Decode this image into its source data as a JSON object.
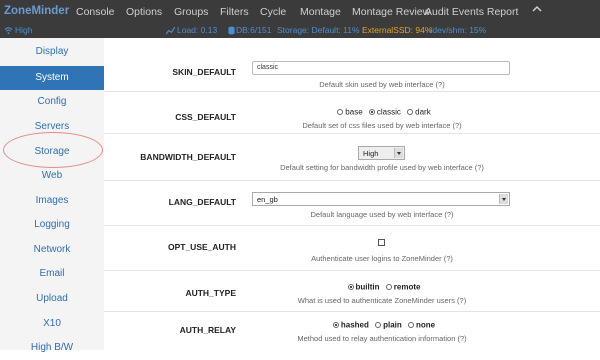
{
  "app": {
    "brand": "ZoneMinder",
    "nav": [
      "Console",
      "Options",
      "Groups",
      "Filters",
      "Cycle",
      "Montage",
      "Montage Review",
      "Audit Events Report"
    ]
  },
  "status": {
    "bandwidth": "High",
    "load": "Load: 0.13",
    "db": "DB:6/151",
    "storage": "Storage: Default: 11%",
    "external": "ExternalSSD: 94%",
    "shm": "/dev/shm: 15%"
  },
  "sidebar": {
    "items": [
      "Display",
      "System",
      "Config",
      "Servers",
      "Storage",
      "Web",
      "Images",
      "Logging",
      "Network",
      "Email",
      "Upload",
      "X10",
      "High B/W"
    ],
    "active": "System"
  },
  "options": {
    "skin_default": {
      "name": "SKIN_DEFAULT",
      "value": "classic",
      "help": "Default skin used by web interface (?)"
    },
    "css_default": {
      "name": "CSS_DEFAULT",
      "choices": [
        "base",
        "classic",
        "dark"
      ],
      "selected": "classic",
      "help": "Default set of css files used by web interface (?)"
    },
    "bandwidth_default": {
      "name": "BANDWIDTH_DEFAULT",
      "value": "High",
      "help": "Default setting for bandwidth profile used by web interface (?)"
    },
    "lang_default": {
      "name": "LANG_DEFAULT",
      "value": "en_gb",
      "help": "Default language used by web interface (?)"
    },
    "opt_use_auth": {
      "name": "OPT_USE_AUTH",
      "checked": false,
      "help": "Authenticate user logins to ZoneMinder (?)"
    },
    "auth_type": {
      "name": "AUTH_TYPE",
      "choices": [
        "builtin",
        "remote"
      ],
      "selected": "builtin",
      "help": "What is used to authenticate ZoneMinder users (?)"
    },
    "auth_relay": {
      "name": "AUTH_RELAY",
      "choices": [
        "hashed",
        "plain",
        "none"
      ],
      "selected": "hashed",
      "help": "Method used to relay authentication information (?)"
    }
  }
}
